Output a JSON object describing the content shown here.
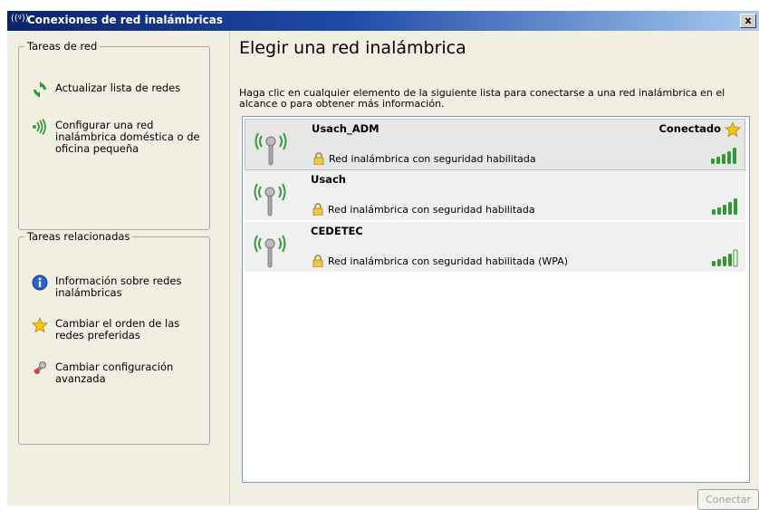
{
  "window": {
    "title": "Conexiones de red inalámbricas",
    "close_label": "x"
  },
  "sidebar": {
    "network_tasks": {
      "legend": "Tareas de red",
      "items": [
        {
          "label": "Actualizar lista de redes",
          "icon": "refresh-icon"
        },
        {
          "label": "Configurar una red inalámbrica doméstica o de oficina pequeña",
          "icon": "wireless-setup-icon"
        }
      ]
    },
    "related_tasks": {
      "legend": "Tareas relacionadas",
      "items": [
        {
          "label": "Información sobre redes inalámbricas",
          "icon": "info-icon"
        },
        {
          "label": "Cambiar el orden de las redes preferidas",
          "icon": "star-icon"
        },
        {
          "label": "Cambiar configuración avanzada",
          "icon": "settings-wrench-icon"
        }
      ]
    }
  },
  "main": {
    "heading": "Elegir una red inalámbrica",
    "instructions": "Haga clic en cualquier elemento de la siguiente lista para conectarse a una red inalámbrica en el alcance o para obtener más información.",
    "networks": [
      {
        "ssid": "Usach_ADM",
        "status": "Conectado",
        "security": "Red inalámbrica con seguridad habilitada",
        "signal_bars": 5,
        "selected": true
      },
      {
        "ssid": "Usach",
        "status": "",
        "security": "Red inalámbrica con seguridad habilitada",
        "signal_bars": 5,
        "selected": false
      },
      {
        "ssid": "CEDETEC",
        "status": "",
        "security": "Red inalámbrica con seguridad habilitada (WPA)",
        "signal_bars": 4,
        "selected": false
      }
    ],
    "connect_button": "Conectar"
  },
  "colors": {
    "title_bar": "#0a246a",
    "panel_bg": "#f1efe2",
    "signal_green": "#2f9a2f",
    "star_gold": "#f5c518"
  }
}
